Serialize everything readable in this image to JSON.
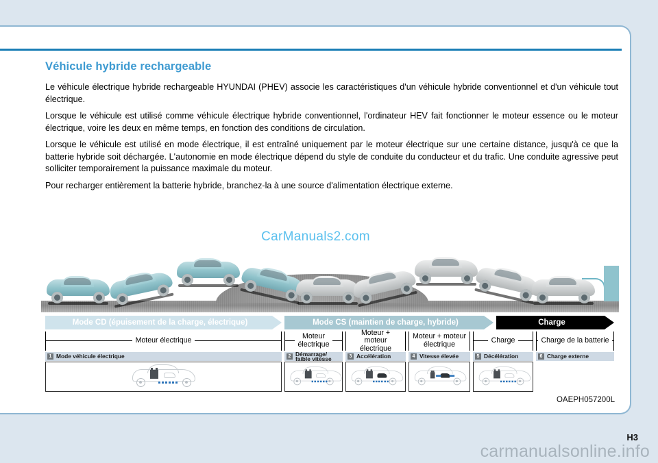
{
  "document": {
    "title": "Véhicule hybride rechargeable",
    "paragraphs": [
      "Le véhicule électrique hybride rechargeable HYUNDAI (PHEV) associe les caractéristiques d'un véhicule hybride conventionnel et d'un véhicule tout électrique.",
      "Lorsque le véhicule est utilisé comme véhicule électrique hybride conventionnel, l'ordinateur HEV fait fonctionner le moteur essence ou le moteur électrique, voire les deux en même temps, en fonction des conditions de circulation.",
      "Lorsque le véhicule est utilisé en mode électrique, il est entraîné uniquement par le moteur électrique sur une certaine distance, jusqu'à ce que la batterie hybride soit déchargée. L'autonomie en mode électrique dépend du style de conduite du conducteur et du trafic. Une conduite agressive peut solliciter temporairement la puissance maximale du moteur.",
      "Pour recharger entièrement la batterie hybride, branchez-la à une source d'alimentation électrique externe."
    ],
    "watermark": "CarManuals2.com",
    "figure_code": "OAEPH057200L",
    "page_number": "H3",
    "footer_brand": "carmanualsonline.info"
  },
  "diagram": {
    "banners": [
      {
        "id": "mode-cd",
        "label": "Mode CD (épuisement de la charge, électrique)",
        "color": "#cfe3ec"
      },
      {
        "id": "mode-cs",
        "label": "Mode CS (maintien de charge, hybride)",
        "color": "#a7c8d2"
      },
      {
        "id": "mode-charge",
        "label": "Charge",
        "color": "#000000"
      }
    ],
    "brackets": [
      {
        "id": "bracket-1",
        "label": "Moteur électrique"
      },
      {
        "id": "bracket-2",
        "label": "Moteur\nélectrique"
      },
      {
        "id": "bracket-3",
        "label": "Moteur + moteur\nélectrique"
      },
      {
        "id": "bracket-4",
        "label": "Moteur + moteur\nélectrique"
      },
      {
        "id": "bracket-5",
        "label": "Charge"
      },
      {
        "id": "bracket-6",
        "label": "Charge de la batterie"
      }
    ],
    "captions": [
      {
        "num": "1",
        "label": "Mode véhicule électrique"
      },
      {
        "num": "2",
        "label": "Démarrage/\nfaible vitesse"
      },
      {
        "num": "3",
        "label": "Accélération"
      },
      {
        "num": "4",
        "label": "Vitesse élevée"
      },
      {
        "num": "5",
        "label": "Décélération"
      },
      {
        "num": "6",
        "label": "Charge externe"
      }
    ]
  },
  "colors": {
    "page_background": "#dce6ef",
    "sheet_border": "#8fb7d3",
    "heading": "#3d9ad1",
    "rule": "#1a7eb5",
    "watermark": "#5bc0ee",
    "accent_flow": "#2a72b8"
  }
}
